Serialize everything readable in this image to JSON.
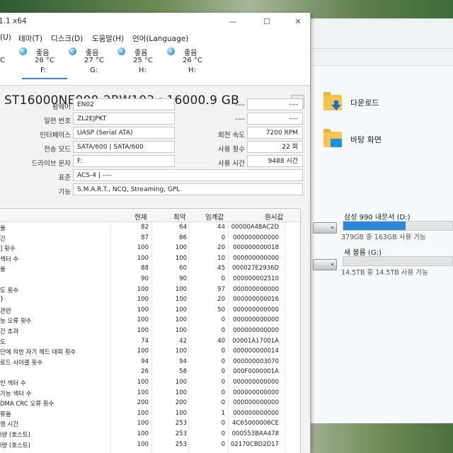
{
  "window": {
    "title": "1.1 x64",
    "minimize": "—",
    "maximize": "☐",
    "close": "✕"
  },
  "menu": [
    {
      "label": "(U)"
    },
    {
      "label": "테마(T)"
    },
    {
      "label": "디스크(D)"
    },
    {
      "label": "도움말(H)"
    },
    {
      "label": "언어(Language)"
    }
  ],
  "disk_tabs": [
    {
      "status": "",
      "temp": "C",
      "letter": "",
      "partial": true
    },
    {
      "status": "좋음",
      "temp": "26 °C",
      "letter": "F:"
    },
    {
      "status": "좋음",
      "temp": "27 °C",
      "letter": "G:"
    },
    {
      "status": "좋음",
      "temp": "25 °C",
      "letter": "H:"
    },
    {
      "status": "좋음",
      "temp": "26 °C",
      "letter": "H:"
    }
  ],
  "disk": {
    "model": "ST16000NE000-2RW103 : 16000.9 GB",
    "next_button": "▶",
    "firmware_label": "펌웨어",
    "firmware": "EN02",
    "serial_label": "일련 번호",
    "serial": "ZL2EJPKT",
    "interface_label": "인터페이스",
    "interface": "UASP (Serial ATA)",
    "transfer_label": "전송 모드",
    "transfer": "SATA/600 | SATA/600",
    "drive_letter_label": "드라이브 문자",
    "drive_letter": "F:",
    "standard_label": "표준",
    "standard": "ACS-4 | ----",
    "features_label": "기능",
    "features": "S.M.A.R.T., NCQ, Streaming, GPL",
    "right_label_1": "----",
    "right_value_1": "----",
    "right_label_2": "----",
    "right_value_2": "----",
    "rotation_label": "회전 속도",
    "rotation": "7200 RPM",
    "power_count_label": "사용 횟수",
    "power_count": "22 회",
    "power_hours_label": "사용 시간",
    "power_hours": "9488 시간"
  },
  "smart": {
    "headers": {
      "current": "현재",
      "worst": "최악",
      "threshold": "임계값",
      "raw": "원시값"
    },
    "rows": [
      {
        "name": "율",
        "current": "82",
        "worst": "64",
        "threshold": "44",
        "raw": "00000A48AC2D"
      },
      {
        "name": "간",
        "current": "87",
        "worst": "86",
        "threshold": "0",
        "raw": "000000000000"
      },
      {
        "name": "] 횟수",
        "current": "100",
        "worst": "100",
        "threshold": "20",
        "raw": "000000000018"
      },
      {
        "name": "섹터 수",
        "current": "100",
        "worst": "100",
        "threshold": "10",
        "raw": "000000000000"
      },
      {
        "name": "율",
        "current": "88",
        "worst": "60",
        "threshold": "45",
        "raw": "000027E2936D"
      },
      {
        "name": "",
        "current": "90",
        "worst": "90",
        "threshold": "0",
        "raw": "000000002510"
      },
      {
        "name": "도 횟수",
        "current": "100",
        "worst": "100",
        "threshold": "97",
        "raw": "000000000000"
      },
      {
        "name": "}",
        "current": "100",
        "worst": "100",
        "threshold": "20",
        "raw": "000000000016"
      },
      {
        "name": "관련",
        "current": "100",
        "worst": "100",
        "threshold": "50",
        "raw": "000000000000"
      },
      {
        "name": "능 오류 횟수",
        "current": "100",
        "worst": "100",
        "threshold": "0",
        "raw": "000000000000"
      },
      {
        "name": "간 초과",
        "current": "100",
        "worst": "100",
        "threshold": "0",
        "raw": "000000000000"
      },
      {
        "name": "도",
        "current": "74",
        "worst": "42",
        "threshold": "40",
        "raw": "00001A17001A"
      },
      {
        "name": "단에 의한 자기 헤드 대피 횟수",
        "current": "100",
        "worst": "100",
        "threshold": "0",
        "raw": "000000000014"
      },
      {
        "name": "로드 사이클 횟수",
        "current": "94",
        "worst": "94",
        "threshold": "0",
        "raw": "000000003070"
      },
      {
        "name": "",
        "current": "26",
        "worst": "58",
        "threshold": "0",
        "raw": "000F0000001A"
      },
      {
        "name": "인 섹터 수",
        "current": "100",
        "worst": "100",
        "threshold": "0",
        "raw": "000000000000"
      },
      {
        "name": "가능 섹터 수",
        "current": "100",
        "worst": "100",
        "threshold": "0",
        "raw": "000000000000"
      },
      {
        "name": "DMA CRC 오류 횟수",
        "current": "200",
        "worst": "200",
        "threshold": "0",
        "raw": "000000000000"
      },
      {
        "name": "류율",
        "current": "100",
        "worst": "100",
        "threshold": "1",
        "raw": "000000000000"
      },
      {
        "name": "행 시간",
        "current": "100",
        "worst": "253",
        "threshold": "0",
        "raw": "4C65000006CE"
      },
      {
        "name": "l량 (호스트)",
        "current": "100",
        "worst": "253",
        "threshold": "0",
        "raw": "000553BAA478"
      },
      {
        "name": "l량 (호스트)",
        "current": "100",
        "worst": "253",
        "threshold": "0",
        "raw": "02170CBD2D17"
      }
    ]
  },
  "explorer": {
    "quick_access": [
      {
        "label": "다운로드",
        "icon": "download-folder-icon"
      },
      {
        "label": "바탕 화면",
        "icon": "desktop-folder-icon"
      }
    ],
    "drives": [
      {
        "name": "삼성 990 내문서 (D:)",
        "info": "379GB 중 163GB 사용 가능",
        "used_fraction": 0.57
      },
      {
        "name": "새 볼륨 (G:)",
        "info": "14.5TB 중 14.5TB 사용 가능",
        "used_fraction": 0.0
      }
    ]
  },
  "colors": {
    "status_good": "#54a9e6",
    "drive_bar": "#2b88d8",
    "selected_tab": "#3b82d6"
  }
}
